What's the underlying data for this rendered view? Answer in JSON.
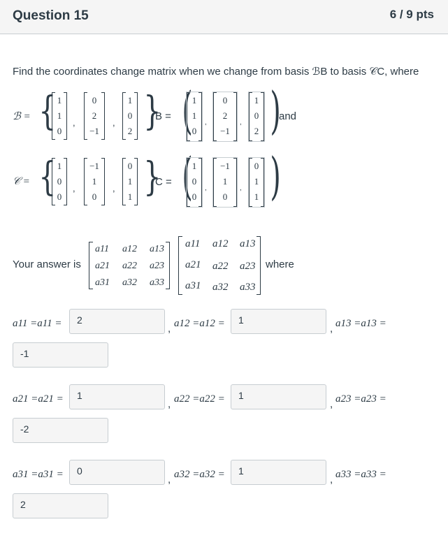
{
  "header": {
    "title": "Question 15",
    "points": "6 / 9 pts"
  },
  "prompt": {
    "text": "Find the coordinates change matrix when we change from basis ℬB to basis 𝒞C, where"
  },
  "basisB": {
    "label": "ℬ =",
    "alt_label": "B =",
    "vectors": [
      [
        "1",
        "1",
        "0"
      ],
      [
        "0",
        "2",
        "−1"
      ],
      [
        "1",
        "0",
        "2"
      ]
    ],
    "suffix": "and"
  },
  "basisC": {
    "label": "𝒞 =",
    "alt_label": "C =",
    "vectors": [
      [
        "1",
        "0",
        "0"
      ],
      [
        "−1",
        "1",
        "0"
      ],
      [
        "0",
        "1",
        "1"
      ]
    ],
    "suffix": "."
  },
  "answer_line": {
    "prefix": "Your answer is",
    "suffix": "where",
    "entries": [
      "a11",
      "a12",
      "a13",
      "a21",
      "a22",
      "a23",
      "a31",
      "a32",
      "a33"
    ]
  },
  "fields": [
    {
      "label": "a11 =a11 =",
      "value": "2"
    },
    {
      "label": "a12 =a12 =",
      "value": "1"
    },
    {
      "label": "a13 =a13 =",
      "value": "-1"
    },
    {
      "label": "a21 =a21 =",
      "value": "1"
    },
    {
      "label": "a22 =a22 =",
      "value": "1"
    },
    {
      "label": "a23 =a23 =",
      "value": "-2"
    },
    {
      "label": "a31 =a31 =",
      "value": "0"
    },
    {
      "label": "a32 =a32 =",
      "value": "1"
    },
    {
      "label": "a33 =a33 =",
      "value": "2"
    }
  ]
}
